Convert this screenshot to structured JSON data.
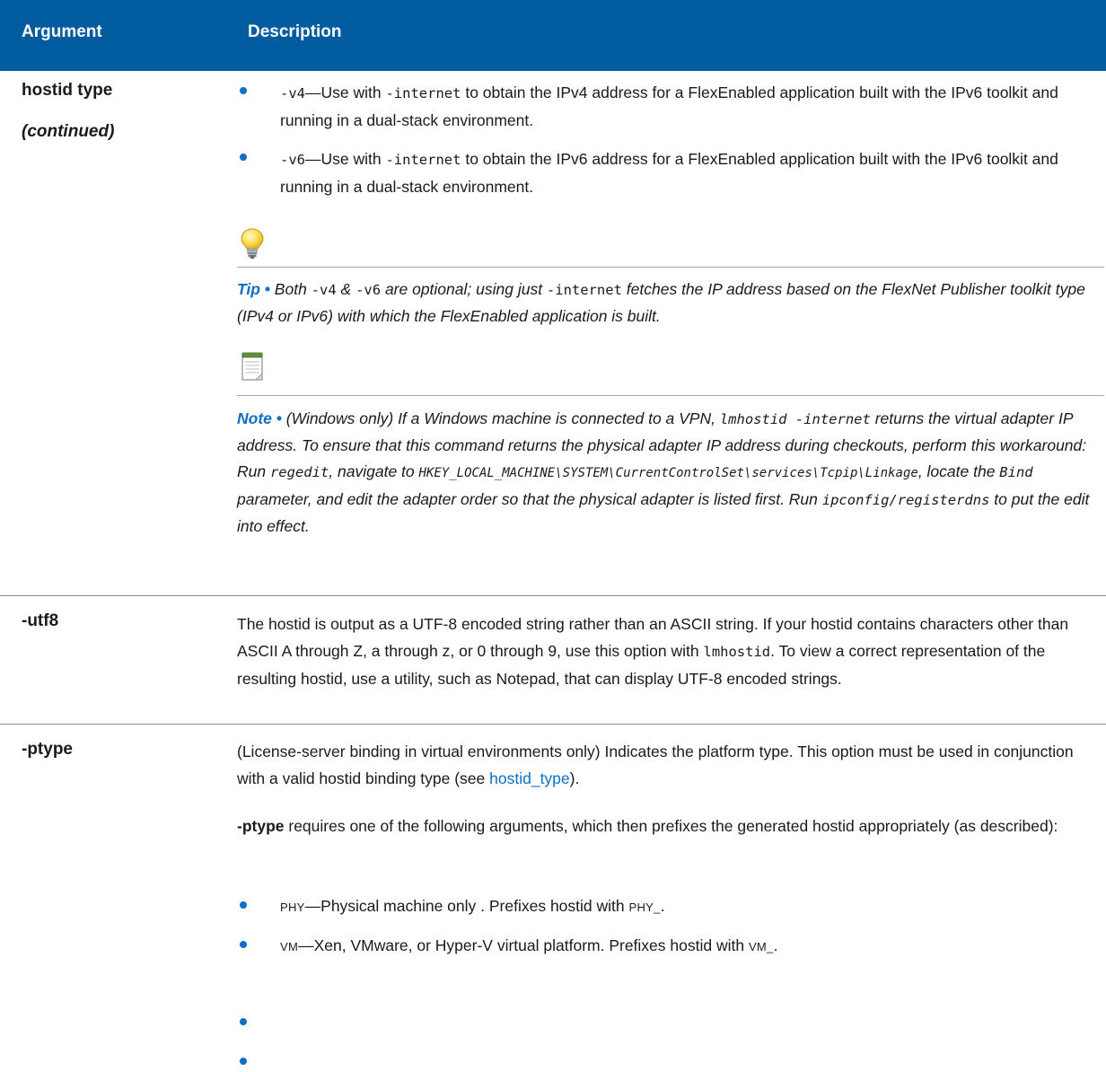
{
  "header": {
    "argument": "Argument",
    "description": "Description"
  },
  "hostid_type": {
    "arg": "hostid type",
    "cont": "(continued)",
    "bullet1": {
      "code": "-v4",
      "sep": "—Use with ",
      "code2": "-internet",
      "rest": " to obtain the IPv4 address for a FlexEnabled application built with the IPv6 toolkit and running in a dual-stack environment."
    },
    "bullet2": {
      "code": "-v6",
      "sep": "—Use with ",
      "code2": "-internet",
      "rest": " to obtain the IPv6 address for a FlexEnabled application built with the IPv6 toolkit and running in a dual-stack environment."
    },
    "tip": {
      "label": "Tip",
      "bullet": " • ",
      "t1": "Both ",
      "c1": "-v4",
      "t2": " & ",
      "c2": "-v6",
      "t3": " are optional; using just ",
      "c3": "-internet",
      "t4": " fetches the IP address based on the FlexNet Publisher toolkit type (IPv4 or IPv6) with which the FlexEnabled application is built."
    },
    "note": {
      "label": "Note",
      "bullet": " • ",
      "t1": "(Windows only) If a Windows machine is connected to a VPN, ",
      "c1": "lmhostid -internet",
      "t2": " returns the virtual adapter IP address. To ensure that this command returns the physical adapter IP address during checkouts, perform this workaround: Run ",
      "c2": "regedit",
      "t3": ", navigate to ",
      "c3": "HKEY_LOCAL_MACHINE\\SYSTEM\\CurrentControlSet\\services\\Tcpip\\Linkage",
      "t4": ", locate the ",
      "c4": "Bind",
      "t5": " parameter, and edit the adapter order so that the physical adapter is listed first. Run ",
      "c5": "ipconfig/registerdns",
      "t6": " to put the edit into effect."
    }
  },
  "utf8": {
    "arg": "-utf8",
    "t1": "The hostid is output as a UTF-8 encoded string rather than an ASCII string. If your hostid contains characters other than ASCII A through Z, a through z, or 0 through 9, use this option with ",
    "c1": "lmhostid",
    "t2": ". To view a correct representation of the resulting hostid, use a utility, such as Notepad, that can display UTF-8 encoded strings."
  },
  "ptype": {
    "arg": "-ptype",
    "p1_text": "(License-server binding in virtual environments only) Indicates the platform type. This option must be used in conjunction with a valid hostid binding type (see ",
    "p1_link": "hostid_type",
    "p1_end": ").",
    "p2_bold": "-ptype",
    "p2_text": " requires one of the following arguments, which then prefixes the generated hostid appropriately (as described):",
    "b1": {
      "code": "PHY",
      "text": "—Physical machine only . Prefixes hostid with ",
      "code2": "PHY_",
      "end": "."
    },
    "b2": {
      "code": "VM",
      "text": "—Xen, VMware, or Hyper-V virtual platform. Prefixes hostid with ",
      "code2": "VM_",
      "end": "."
    }
  },
  "icons": {
    "tip": "lightbulb-icon",
    "note": "notepad-icon"
  },
  "colors": {
    "header_bg": "#005b9f",
    "accent": "#0b6fc6"
  }
}
